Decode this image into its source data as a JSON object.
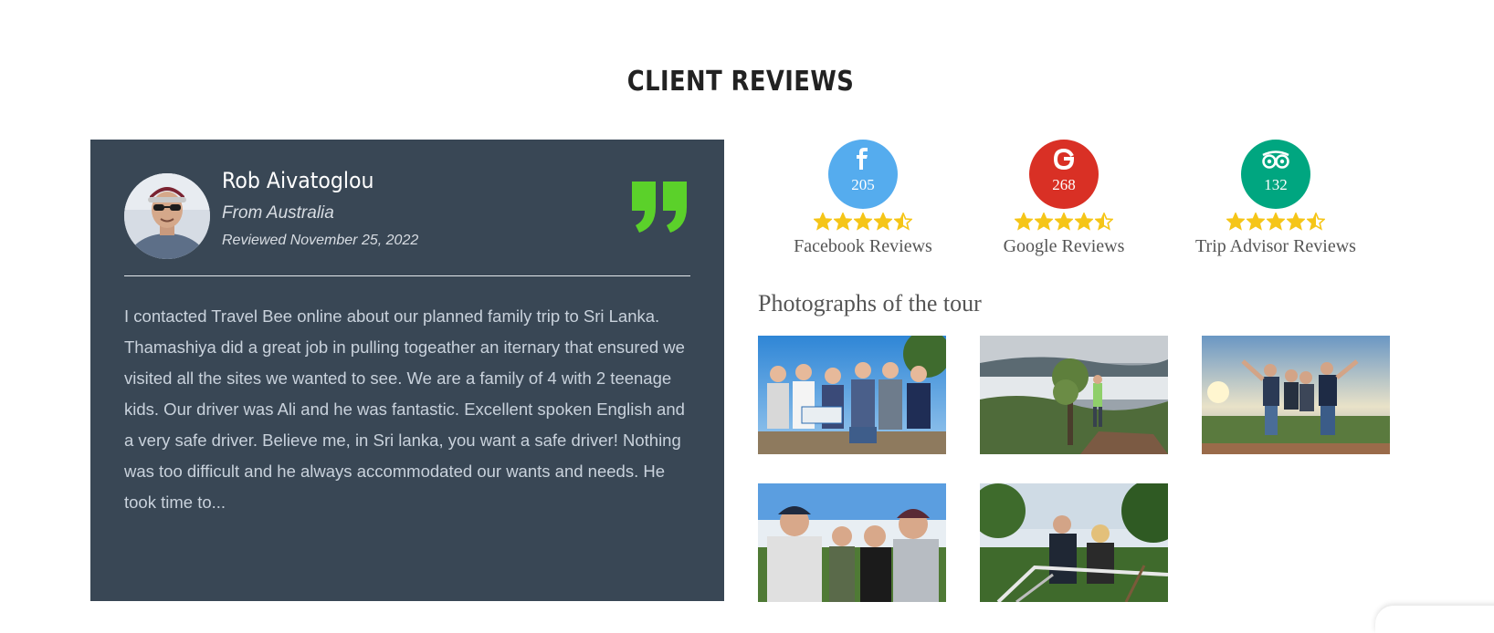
{
  "section": {
    "title": "CLIENT REVIEWS"
  },
  "review": {
    "name": "Rob Aivatoglou",
    "origin": "From Australia",
    "date": "Reviewed November 25, 2022",
    "text": "I contacted Travel Bee online about our planned family trip to Sri Lanka. Thamashiya did a great job in pulling togeather an iternary that ensured we visited all the sites we wanted to see. We are a family of 4 with 2 teenage kids. Our driver was Ali and he was fantastic. Excellent spoken English and a very safe driver. Believe me, in Sri lanka, you want a safe driver! Nothing was too difficult and he always accommodated our wants and needs. He took time to...",
    "card_color": "#394755",
    "quote_color": "#5bd12a",
    "icon": "quote-icon"
  },
  "ratings": [
    {
      "platform": "facebook",
      "count": "205",
      "label": "Facebook Reviews",
      "color": "#55acee",
      "icon": "facebook-icon",
      "stars": 4.5
    },
    {
      "platform": "google",
      "count": "268",
      "label": "Google Reviews",
      "color": "#d93025",
      "icon": "google-icon",
      "stars": 4.5
    },
    {
      "platform": "tripadvisor",
      "count": "132",
      "label": "Trip Advisor Reviews",
      "color": "#00a680",
      "icon": "tripadvisor-icon",
      "stars": 4.5
    }
  ],
  "star_color": "#f5c518",
  "photos": {
    "heading": "Photographs of the tour",
    "items": [
      {
        "name": "photo-family-group-flag"
      },
      {
        "name": "photo-hiker-misty-valley"
      },
      {
        "name": "photo-group-sunset-hilltop"
      },
      {
        "name": "photo-family-selfie"
      },
      {
        "name": "photo-couple-viewpoint"
      }
    ]
  }
}
